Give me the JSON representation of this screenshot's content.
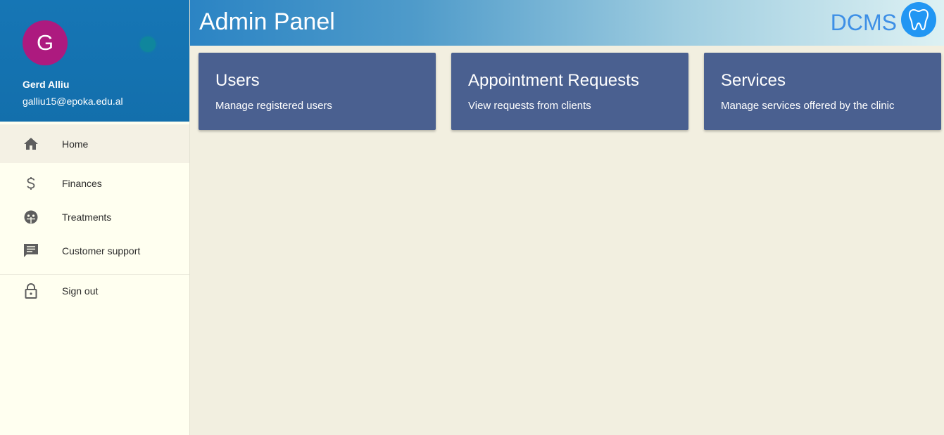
{
  "user": {
    "initial": "G",
    "name": "Gerd Alliu",
    "email": "galliu15@epoka.edu.al"
  },
  "nav": {
    "items": [
      {
        "label": "Home",
        "icon": "home-icon"
      },
      {
        "label": "Finances",
        "icon": "dollar-icon"
      },
      {
        "label": "Treatments",
        "icon": "face-icon"
      },
      {
        "label": "Customer support",
        "icon": "chat-icon"
      },
      {
        "label": "Sign out",
        "icon": "lock-icon"
      }
    ]
  },
  "header": {
    "title": "Admin Panel",
    "brand": "DCMS",
    "logo_icon": "tooth-icon"
  },
  "cards": [
    {
      "title": "Users",
      "description": "Manage registered users"
    },
    {
      "title": "Appointment Requests",
      "description": "View requests from clients"
    },
    {
      "title": "Services",
      "description": "Manage services offered by the clinic"
    }
  ],
  "colors": {
    "sidebar_header": "#1676b5",
    "avatar": "#ad1a7f",
    "card": "#4a6090",
    "brand": "#3d8fe6",
    "background": "#f2efe0"
  }
}
